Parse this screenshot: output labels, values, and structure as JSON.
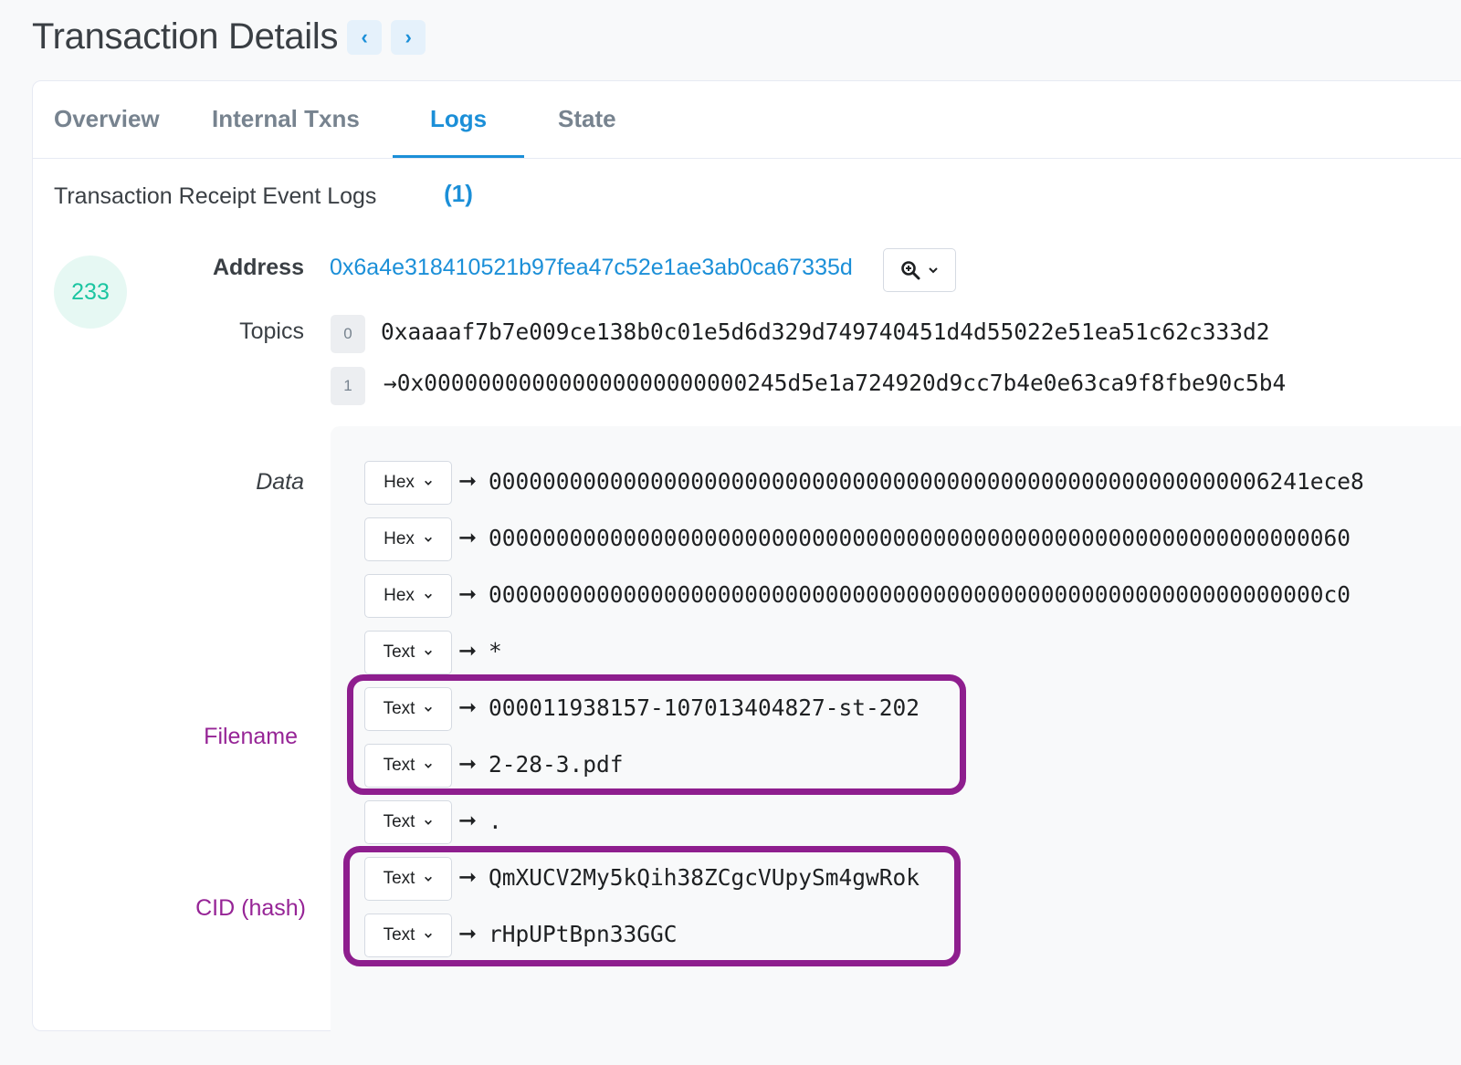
{
  "header": {
    "title": "Transaction Details",
    "prev_glyph": "‹",
    "next_glyph": "›"
  },
  "tabs": [
    {
      "label": "Overview",
      "active": false
    },
    {
      "label": "Internal Txns",
      "active": false
    },
    {
      "label": "Logs (1)",
      "active": true
    },
    {
      "label": "State",
      "active": false
    }
  ],
  "section_title": "Transaction Receipt Event Logs",
  "log": {
    "index": "233",
    "address_label": "Address",
    "address": "0x6a4e318410521b97fea47c52e1ae3ab0ca67335d",
    "topics_label": "Topics",
    "topics": [
      {
        "index": "0",
        "arrow": "",
        "value": "0xaaaaf7b7e009ce138b0c01e5d6d329d749740451d4d55022e51ea51c62c333d2"
      },
      {
        "index": "1",
        "arrow": "→",
        "value": "0x000000000000000000000000245d5e1a724920d9cc7b4e0e63ca9f8fbe90c5b4"
      }
    ],
    "data_label": "Data",
    "data_rows": [
      {
        "format": "Hex",
        "value": "0000000000000000000000000000000000000000000000000000000006241ece8"
      },
      {
        "format": "Hex",
        "value": "0000000000000000000000000000000000000000000000000000000000000060"
      },
      {
        "format": "Hex",
        "value": "00000000000000000000000000000000000000000000000000000000000000c0"
      },
      {
        "format": "Text",
        "value": "*"
      },
      {
        "format": "Text",
        "value": "000011938157-107013404827-st-202"
      },
      {
        "format": "Text",
        "value": "2-28-3.pdf"
      },
      {
        "format": "Text",
        "value": "."
      },
      {
        "format": "Text",
        "value": "QmXUCV2My5kQih38ZCgcVUpySm4gwRok"
      },
      {
        "format": "Text",
        "value": "rHpUPtBpn33GGC"
      }
    ]
  },
  "annotations": {
    "filename": "Filename",
    "cid": "CID (hash)"
  },
  "colors": {
    "accent": "#1b8fd8",
    "annotation": "#8e1e8e",
    "badge": "#1bc5a1"
  }
}
